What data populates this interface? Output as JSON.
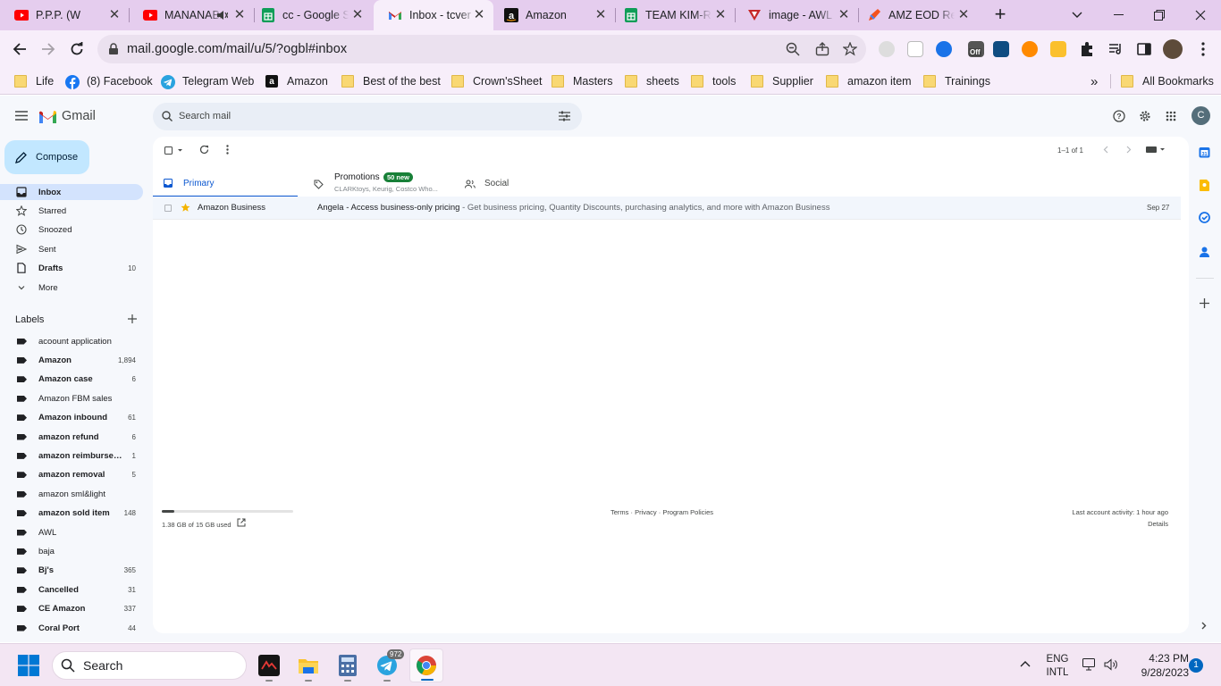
{
  "browser": {
    "tabs": [
      {
        "title": "P.P.P. (W",
        "icon": "youtube-icon"
      },
      {
        "title": "MANANABA",
        "icon": "youtube-icon"
      },
      {
        "title": "cc - Google S",
        "icon": "google-sheets-icon"
      },
      {
        "title": "Inbox - tcver",
        "icon": "gmail-icon"
      },
      {
        "title": "Amazon",
        "icon": "amazon-icon"
      },
      {
        "title": "TEAM KIM-R",
        "icon": "google-sheets-icon"
      },
      {
        "title": "image - AWL",
        "icon": "awl-icon"
      },
      {
        "title": "AMZ EOD Re",
        "icon": "pen-icon"
      }
    ],
    "url": "mail.google.com/mail/u/5/?ogbl#inbox",
    "bookmarks": [
      "Life",
      "(8) Facebook",
      "Telegram Web",
      "Amazon",
      "Best of the best",
      "Crown'sSheet",
      "Masters",
      "sheets",
      "tools",
      "Supplier",
      "amazon item",
      "Trainings"
    ],
    "all_bookmarks": "All Bookmarks",
    "ext_badge": "Off"
  },
  "gmail": {
    "app_name": "Gmail",
    "search_placeholder": "Search mail",
    "compose": "Compose",
    "avatar_letter": "C",
    "nav": [
      {
        "label": "Inbox",
        "icon": "inbox-icon",
        "count": ""
      },
      {
        "label": "Starred",
        "icon": "star-icon",
        "count": ""
      },
      {
        "label": "Snoozed",
        "icon": "clock-icon",
        "count": ""
      },
      {
        "label": "Sent",
        "icon": "send-icon",
        "count": ""
      },
      {
        "label": "Drafts",
        "icon": "draft-icon",
        "count": "10"
      },
      {
        "label": "More",
        "icon": "chevron-down-icon",
        "count": ""
      }
    ],
    "labels_heading": "Labels",
    "labels": [
      {
        "name": "acoount application",
        "count": "",
        "bold": false
      },
      {
        "name": "Amazon",
        "count": "1,894",
        "bold": true
      },
      {
        "name": "Amazon case",
        "count": "6",
        "bold": true
      },
      {
        "name": "Amazon FBM sales",
        "count": "",
        "bold": false
      },
      {
        "name": "Amazon inbound",
        "count": "61",
        "bold": true
      },
      {
        "name": "amazon refund",
        "count": "6",
        "bold": true
      },
      {
        "name": "amazon reimburse…",
        "count": "1",
        "bold": true
      },
      {
        "name": "amazon removal",
        "count": "5",
        "bold": true
      },
      {
        "name": "amazon sml&light",
        "count": "",
        "bold": false
      },
      {
        "name": "amazon sold item",
        "count": "148",
        "bold": true
      },
      {
        "name": "AWL",
        "count": "",
        "bold": false
      },
      {
        "name": "baja",
        "count": "",
        "bold": false
      },
      {
        "name": "Bj's",
        "count": "365",
        "bold": true
      },
      {
        "name": "Cancelled",
        "count": "31",
        "bold": true
      },
      {
        "name": "CE Amazon",
        "count": "337",
        "bold": true
      },
      {
        "name": "Coral Port",
        "count": "44",
        "bold": true
      }
    ],
    "pagination": "1–1 of 1",
    "tabs": {
      "primary": "Primary",
      "promotions": "Promotions",
      "promotions_badge": "50 new",
      "promotions_sub": "CLARKtoys, Keurig, Costco Who...",
      "social": "Social"
    },
    "email": {
      "sender": "Amazon Business",
      "subject": "Angela - Access business-only pricing",
      "snippet": " - Get business pricing, Quantity Discounts, purchasing analytics, and more with Amazon Business",
      "date": "Sep 27"
    },
    "storage": {
      "text": "1.38 GB of 15 GB used",
      "fraction": 0.092
    },
    "footer": {
      "links": "Terms · Privacy · Program Policies",
      "activity": "Last account activity: 1 hour ago",
      "details": "Details"
    }
  },
  "taskbar": {
    "search": "Search",
    "telegram_badge": "972",
    "lang": "ENG",
    "layout": "INTL",
    "time": "4:23 PM",
    "date": "9/28/2023",
    "notification_count": "1"
  }
}
